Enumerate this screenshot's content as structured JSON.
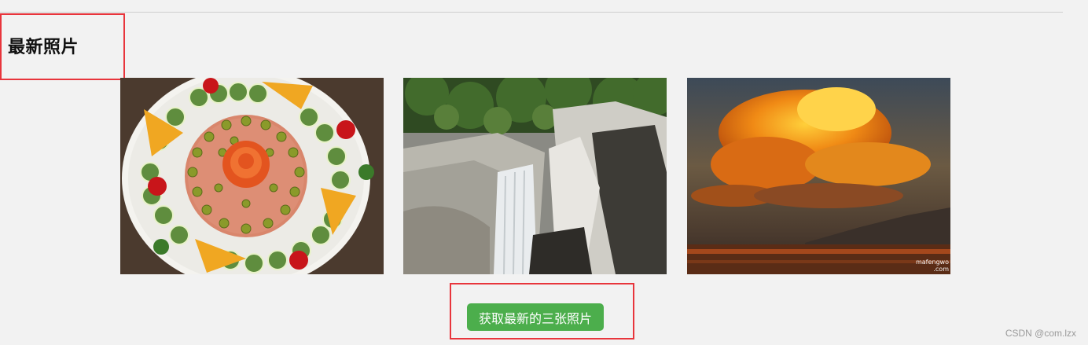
{
  "section": {
    "title": "最新照片"
  },
  "photos": [
    {
      "subject": "food-platter-icon",
      "caption": []
    },
    {
      "subject": "waterfall-icon",
      "caption": []
    },
    {
      "subject": "sunset-clouds-icon",
      "caption": [
        "mafengwo",
        ".com"
      ]
    }
  ],
  "actions": {
    "get_latest_button_label": "获取最新的三张照片"
  },
  "footer": {
    "watermark": "CSDN @com.lzx"
  },
  "colors": {
    "background": "#f2f2f2",
    "button": "#4cae4c",
    "annotation_box": "#e8353c"
  }
}
